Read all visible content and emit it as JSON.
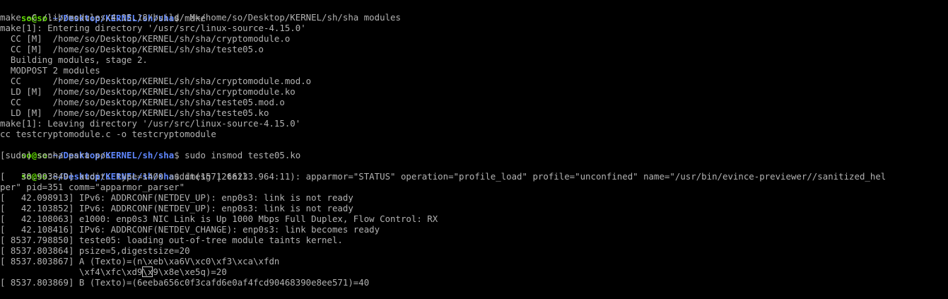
{
  "colors": {
    "background": "#000000",
    "text": "#b2b2b2",
    "prompt_user": "#5fd700",
    "prompt_path": "#5f87ff",
    "cursor": "#c8c8c8"
  },
  "prompt": {
    "user": "so@so",
    "sep": ":",
    "path": "~/Desktop/KERNEL/sh/sha",
    "symbol": "$ "
  },
  "commands": {
    "make": "make",
    "insmod": "sudo insmod teste05.ko",
    "dmesg": "dmesg | tail"
  },
  "make_output": [
    "make -C /lib/modules/4.15.18/build/ M=/home/so/Desktop/KERNEL/sh/sha modules",
    "make[1]: Entering directory '/usr/src/linux-source-4.15.0'",
    "  CC [M]  /home/so/Desktop/KERNEL/sh/sha/cryptomodule.o",
    "  CC [M]  /home/so/Desktop/KERNEL/sh/sha/teste05.o",
    "  Building modules, stage 2.",
    "  MODPOST 2 modules",
    "  CC      /home/so/Desktop/KERNEL/sh/sha/cryptomodule.mod.o",
    "  LD [M]  /home/so/Desktop/KERNEL/sh/sha/cryptomodule.ko",
    "  CC      /home/so/Desktop/KERNEL/sh/sha/teste05.mod.o",
    "  LD [M]  /home/so/Desktop/KERNEL/sh/sha/teste05.ko",
    "make[1]: Leaving directory '/usr/src/linux-source-4.15.0'",
    "cc testcryptomodule.c -o testcryptomodule"
  ],
  "sudo_prompt": "[sudo] senha para so:",
  "dmesg_output": [
    "[   30.993849] audit: type=1400 audit(1571266233.964:11): apparmor=\"STATUS\" operation=\"profile_load\" profile=\"unconfined\" name=\"/usr/bin/evince-previewer//sanitized_hel",
    "per\" pid=351 comm=\"apparmor_parser\"",
    "[   42.098913] IPv6: ADDRCONF(NETDEV_UP): enp0s3: link is not ready",
    "[   42.103852] IPv6: ADDRCONF(NETDEV_UP): enp0s3: link is not ready",
    "[   42.108063] e1000: enp0s3 NIC Link is Up 1000 Mbps Full Duplex, Flow Control: RX",
    "[   42.108416] IPv6: ADDRCONF(NETDEV_CHANGE): enp0s3: link becomes ready",
    "[ 8537.798850] teste05: loading out-of-tree module taints kernel.",
    "[ 8537.803864] psize=5,digestsize=20"
  ],
  "hash_a": {
    "line1": "[ 8537.803867] A (Texto)=(n\\xeb\\xa6V\\xc0\\xf3\\xca\\xfdn",
    "line2_pre": "               \\xf4\\xfc\\xd9",
    "line2_sel": "\\x",
    "line2_post": "9\\x8e\\xe5q)=20"
  },
  "hash_b": "[ 8537.803869] B (Texto)=(6eeba656c0f3cafd6e0af4fcd90468390e8ee571)=40"
}
